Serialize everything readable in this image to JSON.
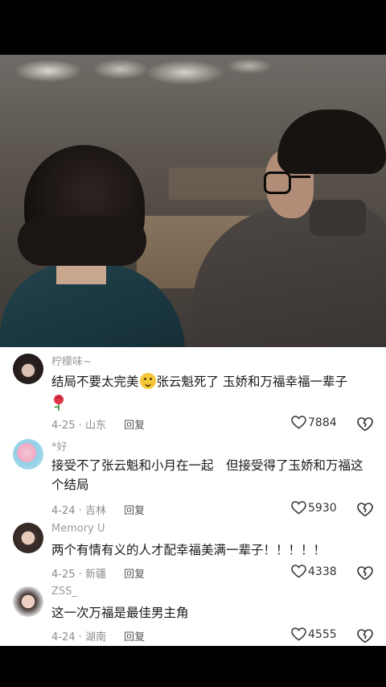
{
  "video": {
    "description_icon": "video-frame"
  },
  "comments": [
    {
      "username": "柠檬味~",
      "text_before_emoji": "结局不要太完美",
      "text_after_emoji": "张云魁死了 玉娇和万福幸福一辈子",
      "date": "4-25",
      "location": "山东",
      "reply_label": "回复",
      "likes": "7884"
    },
    {
      "username": "*好",
      "text": "接受不了张云魁和小月在一起　但接受得了玉娇和万福这个结局",
      "date": "4-24",
      "location": "吉林",
      "reply_label": "回复",
      "likes": "5930"
    },
    {
      "username": "Memory  U",
      "text": "两个有情有义的人才配幸福美满一辈子！！！！！",
      "date": "4-25",
      "location": "新疆",
      "reply_label": "回复",
      "likes": "4338"
    },
    {
      "username": "ZSS_",
      "text": "这一次万福是最佳男主角",
      "date": "4-24",
      "location": "湖南",
      "reply_label": "回复",
      "likes": "4555"
    }
  ],
  "colors": {
    "background": "#ffffff",
    "text": "#1a1a1a",
    "meta": "#8c8c8c"
  }
}
